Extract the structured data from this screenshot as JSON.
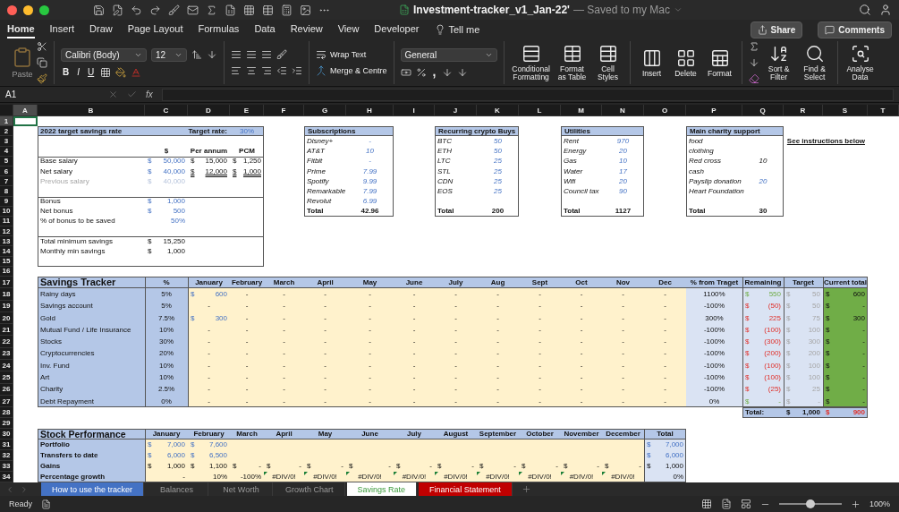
{
  "window": {
    "title": "Investment-tracker_v1_Jan-22'",
    "save_status": "— Saved to my Mac"
  },
  "ribbon_tabs": [
    {
      "label": "Home",
      "selected": true
    },
    {
      "label": "Insert",
      "selected": false
    },
    {
      "label": "Draw",
      "selected": false
    },
    {
      "label": "Page Layout",
      "selected": false
    },
    {
      "label": "Formulas",
      "selected": false
    },
    {
      "label": "Data",
      "selected": false
    },
    {
      "label": "Review",
      "selected": false
    },
    {
      "label": "View",
      "selected": false
    },
    {
      "label": "Developer",
      "selected": false
    }
  ],
  "tell_me": "Tell me",
  "share": "Share",
  "comments": "Comments",
  "ribbon": {
    "paste": "Paste",
    "font": "Calibri (Body)",
    "font_size": "12",
    "format_buttons": [
      "B",
      "I",
      "U"
    ],
    "wrap_text": "Wrap Text",
    "merge": "Merge & Centre",
    "number_format": "General",
    "comma": ",",
    "big_buttons": [
      {
        "label": "Conditional Formatting",
        "kind": "conditional"
      },
      {
        "label": "Format as Table",
        "kind": "table"
      },
      {
        "label": "Cell Styles",
        "kind": "styles"
      },
      {
        "label": "Insert",
        "kind": "insert"
      },
      {
        "label": "Delete",
        "kind": "delete"
      },
      {
        "label": "Format",
        "kind": "format"
      },
      {
        "label": "Sort & Filter",
        "kind": "sort"
      },
      {
        "label": "Find & Select",
        "kind": "find"
      },
      {
        "label": "Analyse Data",
        "kind": "analyse"
      }
    ]
  },
  "formula_bar": {
    "cell_ref": "A1",
    "fx": "fx"
  },
  "columns": [
    {
      "label": "A",
      "selected": true
    },
    {
      "label": "B",
      "selected": false
    },
    {
      "label": "C",
      "selected": false
    },
    {
      "label": "D",
      "selected": false
    },
    {
      "label": "E",
      "selected": false
    },
    {
      "label": "F",
      "selected": false
    },
    {
      "label": "G",
      "selected": false
    },
    {
      "label": "H",
      "selected": false
    },
    {
      "label": "I",
      "selected": false
    },
    {
      "label": "J",
      "selected": false
    },
    {
      "label": "K",
      "selected": false
    },
    {
      "label": "L",
      "selected": false
    },
    {
      "label": "M",
      "selected": false
    },
    {
      "label": "N",
      "selected": false
    },
    {
      "label": "O",
      "selected": false
    },
    {
      "label": "P",
      "selected": false
    },
    {
      "label": "Q",
      "selected": false
    },
    {
      "label": "R",
      "selected": false
    },
    {
      "label": "S",
      "selected": false
    },
    {
      "label": "T",
      "selected": false
    }
  ],
  "rows": [
    {
      "label": "1",
      "selected": true
    },
    {
      "label": "2",
      "selected": false
    },
    {
      "label": "3",
      "selected": false
    },
    {
      "label": "4",
      "selected": false
    },
    {
      "label": "5",
      "selected": false
    },
    {
      "label": "6",
      "selected": false
    },
    {
      "label": "7",
      "selected": false
    },
    {
      "label": "8",
      "selected": false
    },
    {
      "label": "9",
      "selected": false
    },
    {
      "label": "10",
      "selected": false
    },
    {
      "label": "11",
      "selected": false
    },
    {
      "label": "12",
      "selected": false
    },
    {
      "label": "13",
      "selected": false
    },
    {
      "label": "14",
      "selected": false
    },
    {
      "label": "15",
      "selected": false
    },
    {
      "label": "16",
      "selected": false
    },
    {
      "label": "17",
      "selected": false
    },
    {
      "label": "18",
      "selected": false
    },
    {
      "label": "19",
      "selected": false
    },
    {
      "label": "20",
      "selected": false
    },
    {
      "label": "21",
      "selected": false
    },
    {
      "label": "22",
      "selected": false
    },
    {
      "label": "23",
      "selected": false
    },
    {
      "label": "24",
      "selected": false
    },
    {
      "label": "25",
      "selected": false
    },
    {
      "label": "26",
      "selected": false
    },
    {
      "label": "27",
      "selected": false
    },
    {
      "label": "28",
      "selected": false
    },
    {
      "label": "29",
      "selected": false
    },
    {
      "label": "30",
      "selected": false
    },
    {
      "label": "31",
      "selected": false
    },
    {
      "label": "32",
      "selected": false
    },
    {
      "label": "33",
      "selected": false
    },
    {
      "label": "34",
      "selected": false
    }
  ],
  "savings_rate": {
    "title": "2022 target savings rate",
    "target_label": "Target rate:",
    "target_value": "30%",
    "columns": [
      "$",
      "Per annum",
      "PCM"
    ],
    "groups": [
      [
        {
          "label": "Base salary",
          "muted": false,
          "values": [
            {
              "c": "$",
              "v": "50,000",
              "kind": "input"
            },
            {
              "c": "$",
              "v": "15,000",
              "kind": "calc"
            },
            {
              "c": "$",
              "v": "1,250",
              "kind": "calc"
            }
          ]
        },
        {
          "label": "Net salary",
          "muted": false,
          "values": [
            {
              "c": "$",
              "v": "40,000",
              "kind": "input"
            },
            {
              "c": "$",
              "v": "12,000",
              "kind": "calc",
              "underlined": true
            },
            {
              "c": "$",
              "v": "1,000",
              "kind": "calc",
              "underlined": true
            }
          ]
        },
        {
          "label": "Previous salary",
          "muted": true,
          "values": [
            {
              "c": "$",
              "v": "40,000",
              "kind": "muted"
            }
          ]
        }
      ],
      [
        {
          "label": "Bonus",
          "muted": false,
          "values": [
            {
              "c": "$",
              "v": "1,000",
              "kind": "input"
            }
          ]
        },
        {
          "label": "Net bonus",
          "muted": false,
          "values": [
            {
              "c": "$",
              "v": "500",
              "kind": "input"
            }
          ]
        },
        {
          "label": "% of bonus to be saved",
          "muted": false,
          "values": [
            {
              "v": "50%",
              "kind": "input"
            }
          ]
        }
      ],
      [
        {
          "label": "Total minimum savings",
          "muted": false,
          "values": [
            {
              "c": "$",
              "v": "15,250",
              "kind": "calc"
            }
          ]
        },
        {
          "label": "Monthly min savings",
          "muted": false,
          "values": [
            {
              "c": "$",
              "v": "1,000",
              "kind": "calc"
            }
          ]
        }
      ]
    ]
  },
  "lists": [
    {
      "title": "Subscriptions",
      "items": [
        {
          "name": "Disney+",
          "value": "-",
          "kind": "input"
        },
        {
          "name": "AT&T",
          "value": "10",
          "kind": "input"
        },
        {
          "name": "Fitbit",
          "value": "-",
          "kind": "input"
        },
        {
          "name": "Prime",
          "value": "7.99",
          "kind": "input"
        },
        {
          "name": "Spotify",
          "value": "9.99",
          "kind": "input"
        },
        {
          "name": "Remarkable",
          "value": "7.99",
          "kind": "input"
        },
        {
          "name": "Revolut",
          "value": "6.99",
          "kind": "input"
        }
      ],
      "total_label": "Total",
      "total": "42.96"
    },
    {
      "title": "Recurring crypto Buys",
      "items": [
        {
          "name": "BTC",
          "value": "50",
          "kind": "input"
        },
        {
          "name": "ETH",
          "value": "50",
          "kind": "input"
        },
        {
          "name": "LTC",
          "value": "25",
          "kind": "input"
        },
        {
          "name": "STL",
          "value": "25",
          "kind": "input"
        },
        {
          "name": "CDN",
          "value": "25",
          "kind": "input"
        },
        {
          "name": "EOS",
          "value": "25",
          "kind": "input"
        }
      ],
      "total_label": "Total",
      "total": "200"
    },
    {
      "title": "Utilities",
      "items": [
        {
          "name": "Rent",
          "value": "970",
          "kind": "input"
        },
        {
          "name": "Energy",
          "value": "20",
          "kind": "input"
        },
        {
          "name": "Gas",
          "value": "10",
          "kind": "input"
        },
        {
          "name": "Water",
          "value": "17",
          "kind": "input"
        },
        {
          "name": "Wifi",
          "value": "20",
          "kind": "input"
        },
        {
          "name": "Council tax",
          "value": "90",
          "kind": "input"
        }
      ],
      "total_label": "Total",
      "total": "1127"
    },
    {
      "title": "Main charity support",
      "items": [
        {
          "name": "food"
        },
        {
          "name": "clothing"
        },
        {
          "name": "Red cross",
          "value": "10",
          "kind": "calc"
        },
        {
          "name": "cash"
        },
        {
          "name": "Payslip donation",
          "value": "20",
          "kind": "input"
        },
        {
          "name": "Heart Foundation"
        }
      ],
      "total_label": "Total",
      "total": "30"
    }
  ],
  "instructions_link": "See instructions below",
  "tracker": {
    "title": "Savings Tracker",
    "pct_header": "%",
    "months": [
      "January",
      "February",
      "March",
      "April",
      "May",
      "June",
      "July",
      "Aug",
      "Sept",
      "Oct",
      "Nov",
      "Dec"
    ],
    "extra_headers": [
      "% from Traget",
      "Remaining",
      "Target",
      "Current total"
    ],
    "rows": [
      {
        "name": "Rainy days",
        "pct": "5%",
        "months": [
          {
            "c": "$",
            "v": "600",
            "kind": "input"
          },
          {
            "v": "-"
          },
          {
            "v": "-"
          },
          {
            "v": "-"
          },
          {
            "v": "-"
          },
          {
            "v": "-"
          },
          {
            "v": "-"
          },
          {
            "v": "-"
          },
          {
            "v": "-"
          },
          {
            "v": "-"
          },
          {
            "v": "-"
          },
          {
            "v": "-"
          }
        ],
        "from_target": "1100%",
        "remaining": {
          "c": "$",
          "v": "550",
          "kind": "gain"
        },
        "target": {
          "c": "$",
          "v": "50",
          "kind": "ref"
        },
        "current": {
          "c": "$",
          "v": "600"
        }
      },
      {
        "name": "Savings account",
        "pct": "5%",
        "months": [
          {
            "v": "-"
          },
          {
            "v": "-"
          },
          {
            "v": "-"
          },
          {
            "v": "-"
          },
          {
            "v": "-"
          },
          {
            "v": "-"
          },
          {
            "v": "-"
          },
          {
            "v": "-"
          },
          {
            "v": "-"
          },
          {
            "v": "-"
          },
          {
            "v": "-"
          },
          {
            "v": "-"
          }
        ],
        "from_target": "-100%",
        "remaining": {
          "c": "$",
          "v": "(50)",
          "kind": "loss"
        },
        "target": {
          "c": "$",
          "v": "50",
          "kind": "ref"
        },
        "current": {
          "c": "$",
          "v": "-"
        }
      },
      {
        "name": "Gold",
        "pct": "7.5%",
        "months": [
          {
            "c": "$",
            "v": "300",
            "kind": "input"
          },
          {
            "v": "-"
          },
          {
            "v": "-"
          },
          {
            "v": "-"
          },
          {
            "v": "-"
          },
          {
            "v": "-"
          },
          {
            "v": "-"
          },
          {
            "v": "-"
          },
          {
            "v": "-"
          },
          {
            "v": "-"
          },
          {
            "v": "-"
          },
          {
            "v": "-"
          }
        ],
        "from_target": "300%",
        "remaining": {
          "c": "$",
          "v": "225",
          "kind": "loss"
        },
        "target": {
          "c": "$",
          "v": "75",
          "kind": "ref"
        },
        "current": {
          "c": "$",
          "v": "300"
        }
      },
      {
        "name": "Mutual Fund / Life Insurance",
        "pct": "10%",
        "months": [
          {
            "v": "-"
          },
          {
            "v": "-"
          },
          {
            "v": "-"
          },
          {
            "v": "-"
          },
          {
            "v": "-"
          },
          {
            "v": "-"
          },
          {
            "v": "-"
          },
          {
            "v": "-"
          },
          {
            "v": "-"
          },
          {
            "v": "-"
          },
          {
            "v": "-"
          },
          {
            "v": "-"
          }
        ],
        "from_target": "-100%",
        "remaining": {
          "c": "$",
          "v": "(100)",
          "kind": "loss"
        },
        "target": {
          "c": "$",
          "v": "100",
          "kind": "ref"
        },
        "current": {
          "c": "$",
          "v": "-"
        }
      },
      {
        "name": "Stocks",
        "pct": "30%",
        "months": [
          {
            "v": "-"
          },
          {
            "v": "-"
          },
          {
            "v": "-"
          },
          {
            "v": "-"
          },
          {
            "v": "-"
          },
          {
            "v": "-"
          },
          {
            "v": "-"
          },
          {
            "v": "-"
          },
          {
            "v": "-"
          },
          {
            "v": "-"
          },
          {
            "v": "-"
          },
          {
            "v": "-"
          }
        ],
        "from_target": "-100%",
        "remaining": {
          "c": "$",
          "v": "(300)",
          "kind": "loss"
        },
        "target": {
          "c": "$",
          "v": "300",
          "kind": "ref"
        },
        "current": {
          "c": "$",
          "v": "-"
        }
      },
      {
        "name": "Cryptocurrencies",
        "pct": "20%",
        "months": [
          {
            "v": "-"
          },
          {
            "v": "-"
          },
          {
            "v": "-"
          },
          {
            "v": "-"
          },
          {
            "v": "-"
          },
          {
            "v": "-"
          },
          {
            "v": "-"
          },
          {
            "v": "-"
          },
          {
            "v": "-"
          },
          {
            "v": "-"
          },
          {
            "v": "-"
          },
          {
            "v": "-"
          }
        ],
        "from_target": "-100%",
        "remaining": {
          "c": "$",
          "v": "(200)",
          "kind": "loss"
        },
        "target": {
          "c": "$",
          "v": "200",
          "kind": "ref"
        },
        "current": {
          "c": "$",
          "v": "-"
        }
      },
      {
        "name": "Inv. Fund",
        "pct": "10%",
        "months": [
          {
            "v": "-"
          },
          {
            "v": "-"
          },
          {
            "v": "-"
          },
          {
            "v": "-"
          },
          {
            "v": "-"
          },
          {
            "v": "-"
          },
          {
            "v": "-"
          },
          {
            "v": "-"
          },
          {
            "v": "-"
          },
          {
            "v": "-"
          },
          {
            "v": "-"
          },
          {
            "v": "-"
          }
        ],
        "from_target": "-100%",
        "remaining": {
          "c": "$",
          "v": "(100)",
          "kind": "loss"
        },
        "target": {
          "c": "$",
          "v": "100",
          "kind": "ref"
        },
        "current": {
          "c": "$",
          "v": "-"
        }
      },
      {
        "name": "Art",
        "pct": "10%",
        "months": [
          {
            "v": "-"
          },
          {
            "v": "-"
          },
          {
            "v": "-"
          },
          {
            "v": "-"
          },
          {
            "v": "-"
          },
          {
            "v": "-"
          },
          {
            "v": "-"
          },
          {
            "v": "-"
          },
          {
            "v": "-"
          },
          {
            "v": "-"
          },
          {
            "v": "-"
          },
          {
            "v": "-"
          }
        ],
        "from_target": "-100%",
        "remaining": {
          "c": "$",
          "v": "(100)",
          "kind": "loss"
        },
        "target": {
          "c": "$",
          "v": "100",
          "kind": "ref"
        },
        "current": {
          "c": "$",
          "v": "-"
        }
      },
      {
        "name": "Charity",
        "pct": "2.5%",
        "months": [
          {
            "v": "-"
          },
          {
            "v": "-"
          },
          {
            "v": "-"
          },
          {
            "v": "-"
          },
          {
            "v": "-"
          },
          {
            "v": "-"
          },
          {
            "v": "-"
          },
          {
            "v": "-"
          },
          {
            "v": "-"
          },
          {
            "v": "-"
          },
          {
            "v": "-"
          },
          {
            "v": "-"
          }
        ],
        "from_target": "-100%",
        "remaining": {
          "c": "$",
          "v": "(25)",
          "kind": "loss"
        },
        "target": {
          "c": "$",
          "v": "25",
          "kind": "ref"
        },
        "current": {
          "c": "$",
          "v": "-"
        }
      },
      {
        "name": "Debt Repayment",
        "pct": "0%",
        "months": [
          {
            "v": "-"
          },
          {
            "v": "-"
          },
          {
            "v": "-"
          },
          {
            "v": "-"
          },
          {
            "v": "-"
          },
          {
            "v": "-"
          },
          {
            "v": "-"
          },
          {
            "v": "-"
          },
          {
            "v": "-"
          },
          {
            "v": "-"
          },
          {
            "v": "-"
          },
          {
            "v": "-"
          }
        ],
        "from_target": "0%",
        "remaining": {
          "c": "$",
          "v": "-",
          "kind": "gain"
        },
        "target": {
          "c": "$",
          "v": "-",
          "kind": "ref"
        },
        "current": {
          "c": "$",
          "v": "-"
        }
      }
    ],
    "total_label": "Total:",
    "target_total": {
      "c": "$",
      "v": "1,000"
    },
    "current_total": {
      "c": "$",
      "v": "900",
      "kind": "loss"
    }
  },
  "stock": {
    "title": "Stock Performance",
    "months": [
      "January",
      "February",
      "March",
      "April",
      "May",
      "June",
      "July",
      "August",
      "September",
      "October",
      "November",
      "December"
    ],
    "total_header": "Total",
    "rows": [
      {
        "name": "Portfolio",
        "months": [
          {
            "c": "$",
            "v": "7,000",
            "kind": "input"
          },
          {
            "c": "$",
            "v": "7,600",
            "kind": "input"
          }
        ],
        "total": {
          "c": "$",
          "v": "7,000",
          "kind": "input"
        }
      },
      {
        "name": "Transfers to date",
        "months": [
          {
            "c": "$",
            "v": "6,000",
            "kind": "input"
          },
          {
            "c": "$",
            "v": "6,500",
            "kind": "input"
          }
        ],
        "total": {
          "c": "$",
          "v": "6,000",
          "kind": "input"
        }
      },
      {
        "name": "Gains",
        "months": [
          {
            "c": "$",
            "v": "1,000"
          },
          {
            "c": "$",
            "v": "1,100"
          },
          {
            "c": "$",
            "v": "-"
          },
          {
            "c": "$",
            "v": "-"
          },
          {
            "c": "$",
            "v": "-"
          },
          {
            "c": "$",
            "v": "-"
          },
          {
            "c": "$",
            "v": "-"
          },
          {
            "c": "$",
            "v": "-"
          },
          {
            "c": "$",
            "v": "-"
          },
          {
            "c": "$",
            "v": "-"
          },
          {
            "c": "$",
            "v": "-"
          },
          {
            "c": "$",
            "v": "-"
          }
        ],
        "total": {
          "c": "$",
          "v": "1,000"
        }
      },
      {
        "name": "Percentage growth",
        "months": [
          {
            "v": "-"
          },
          {
            "v": "10%"
          },
          {
            "v": "-100%"
          },
          {
            "v": "#DIV/0!",
            "kind": "error"
          },
          {
            "v": "#DIV/0!",
            "kind": "error"
          },
          {
            "v": "#DIV/0!",
            "kind": "error"
          },
          {
            "v": "#DIV/0!",
            "kind": "error"
          },
          {
            "v": "#DIV/0!",
            "kind": "error"
          },
          {
            "v": "#DIV/0!",
            "kind": "error"
          },
          {
            "v": "#DIV/0!",
            "kind": "error"
          },
          {
            "v": "#DIV/0!",
            "kind": "error"
          },
          {
            "v": "#DIV/0!",
            "kind": "error"
          }
        ],
        "total": {
          "v": "0%"
        }
      }
    ]
  },
  "sheet_tabs": [
    {
      "label": "How to use the tracker",
      "selected": false,
      "color": "#4472c4"
    },
    {
      "label": "Balances",
      "selected": false
    },
    {
      "label": "Net Worth",
      "selected": false
    },
    {
      "label": "Growth Chart",
      "selected": false
    },
    {
      "label": "Savings Rate",
      "selected": true
    },
    {
      "label": "Financial Statement",
      "selected": false,
      "color": "#c00000"
    }
  ],
  "status": {
    "text": "Ready",
    "zoom": "100%",
    "zoom_slider": {
      "level": 0.5
    }
  }
}
